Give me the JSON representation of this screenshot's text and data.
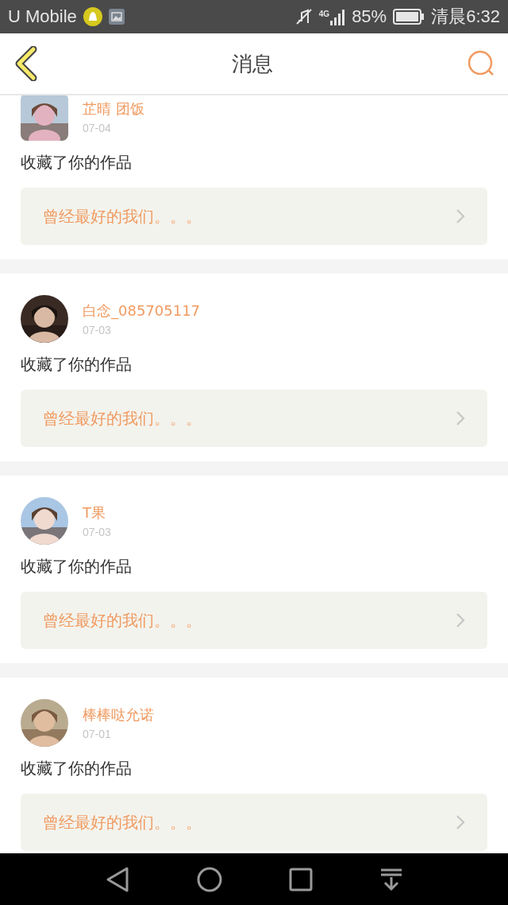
{
  "status_bar": {
    "carrier": "U Mobile",
    "network": "4G",
    "battery": "85%",
    "time": "清晨6:32"
  },
  "header": {
    "title": "消息"
  },
  "messages": [
    {
      "name": "芷晴 团饭",
      "date": "07-04",
      "action": "收藏了你的作品",
      "work_title": "曾经最好的我们。。。",
      "kind": "square"
    },
    {
      "name": "白念_085705117",
      "date": "07-03",
      "action": "收藏了你的作品",
      "work_title": "曾经最好的我们。。。",
      "kind": "round"
    },
    {
      "name": "T果",
      "date": "07-03",
      "action": "收藏了你的作品",
      "work_title": "曾经最好的我们。。。",
      "kind": "round"
    },
    {
      "name": "棒棒哒允诺",
      "date": "07-01",
      "action": "收藏了你的作品",
      "work_title": "曾经最好的我们。。。",
      "kind": "round"
    }
  ]
}
